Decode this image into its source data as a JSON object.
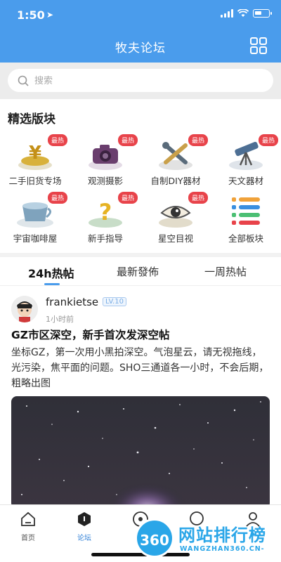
{
  "status_bar": {
    "time": "1:50",
    "location_icon": "location-arrow-icon"
  },
  "header": {
    "title": "牧夫论坛",
    "grid_icon": "grid-icon"
  },
  "search": {
    "placeholder": "搜索"
  },
  "featured": {
    "title": "精选版块",
    "categories": [
      {
        "label": "二手旧货专场",
        "badge": "最热",
        "icon": "yen-coin-icon"
      },
      {
        "label": "观测摄影",
        "badge": "最热",
        "icon": "camera-icon"
      },
      {
        "label": "自制DIY器材",
        "badge": "最热",
        "icon": "tools-icon"
      },
      {
        "label": "天文器材",
        "badge": "最热",
        "icon": "telescope-icon"
      },
      {
        "label": "宇宙咖啡屋",
        "badge": "最热",
        "icon": "coffee-cup-icon"
      },
      {
        "label": "新手指导",
        "badge": "最热",
        "icon": "question-icon"
      },
      {
        "label": "星空目视",
        "badge": "最热",
        "icon": "eye-icon"
      },
      {
        "label": "全部板块",
        "badge": "",
        "icon": "list-icon"
      }
    ]
  },
  "tabs": [
    {
      "label": "24h热帖",
      "active": true
    },
    {
      "label": "最新發佈",
      "active": false
    },
    {
      "label": "一周热帖",
      "active": false
    }
  ],
  "post": {
    "username": "frankietse",
    "level": "LV.10",
    "time": "1小时前",
    "title": "GZ市区深空，新手首次发深空帖",
    "body": "坐标GZ，第一次用小黑拍深空。气泡星云，请无视拖线，光污染，焦平面的问题。SHO三通道各一小时，不会后期，粗略出图"
  },
  "bottom_nav": [
    {
      "label": "首页",
      "icon": "home-icon",
      "active": false
    },
    {
      "label": "论坛",
      "icon": "forum-icon",
      "active": true
    },
    {
      "label": "天",
      "icon": "sky-icon",
      "active": false
    },
    {
      "label": "",
      "icon": "chat-icon",
      "active": false
    },
    {
      "label": "",
      "icon": "user-icon",
      "active": false
    }
  ],
  "watermark": {
    "logo": "360",
    "text": "网站排行榜",
    "domain": "WANGZHAN360.CN-"
  },
  "colors": {
    "primary": "#4a9cec",
    "hot_badge": "#e8434a",
    "active_nav": "#2e7fd6"
  }
}
